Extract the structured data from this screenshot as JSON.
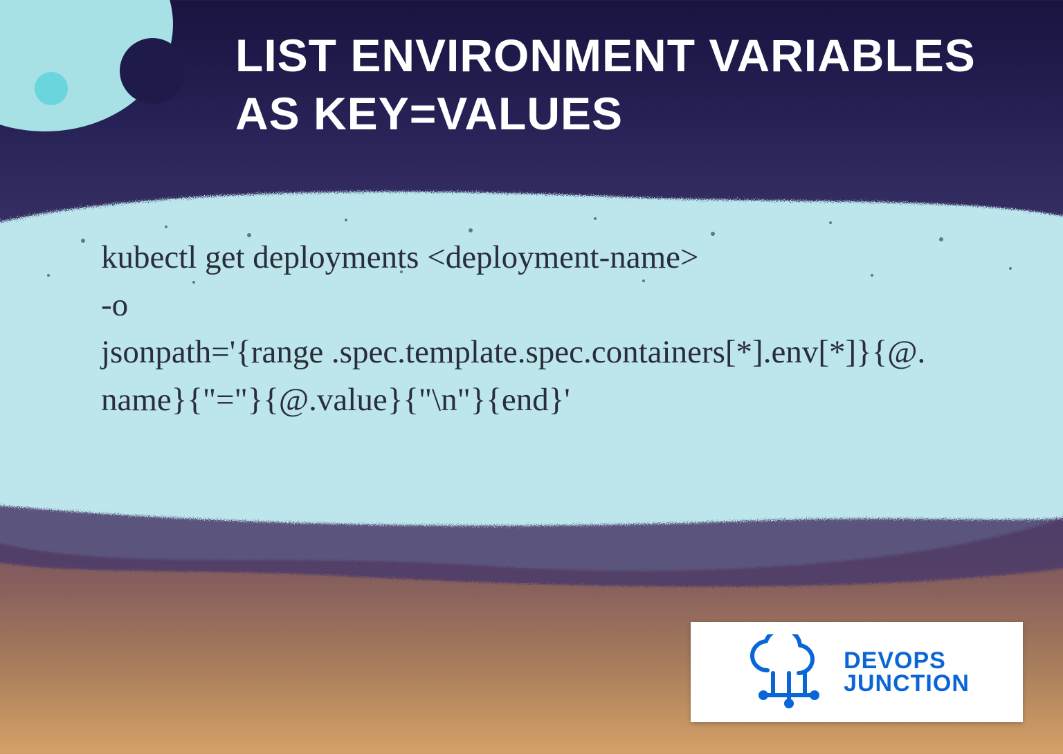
{
  "title": "LIST ENVIRONMENT VARIABLES AS KEY=VALUES",
  "code": "kubectl get deployments <deployment-name>\n-o\njsonpath='{range .spec.template.spec.containers[*].env[*]}{@.name}{\"=\"}{@.value}{\"\\n\"}{end}'",
  "logo": {
    "line1": "DEVOPS",
    "line2": "JUNCTION"
  },
  "colors": {
    "accentLight": "#a7e1e6",
    "accentTeal": "#6ad5dc",
    "brush": "#bce6eb",
    "brand": "#0a66d6"
  }
}
